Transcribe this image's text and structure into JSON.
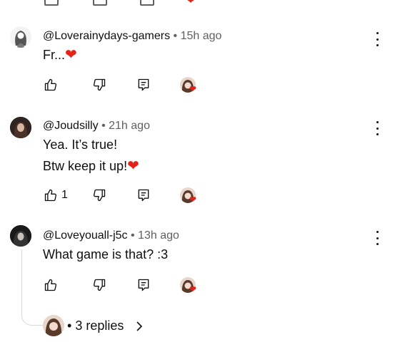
{
  "comments": [
    {
      "handle": "@Loverainydays-gamers",
      "sep": "•",
      "time": "15h ago",
      "lines": [
        "Fr..."
      ],
      "emoji": "heart",
      "likes": ""
    },
    {
      "handle": "@Joudsilly",
      "sep": "•",
      "time": "21h ago",
      "lines": [
        "Yea. It’s true!",
        "Btw keep it up!"
      ],
      "emoji": "heart",
      "likes": "1"
    },
    {
      "handle": "@Loveyouall-j5c",
      "sep": "•",
      "time": "13h ago",
      "lines": [
        "What game is that? :3"
      ],
      "emoji": "",
      "likes": ""
    }
  ],
  "replies": {
    "dot": "•",
    "label": "3 replies"
  },
  "icons": {
    "like": "thumbs-up-icon",
    "dislike": "thumbs-down-icon",
    "reply": "reply-comment-icon",
    "more": "more-vertical-icon",
    "chevron": "chevron-right-icon"
  },
  "colors": {
    "heart": "#e62117",
    "secondary_text": "#606060",
    "text": "#0f0f0f",
    "thread_line": "#d9d9d9"
  }
}
